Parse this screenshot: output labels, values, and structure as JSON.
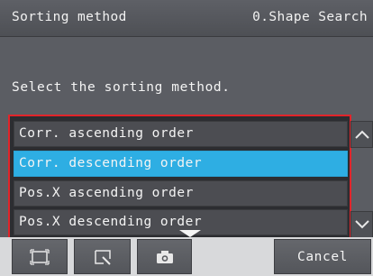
{
  "header": {
    "title": "Sorting method",
    "context": "0.Shape Search"
  },
  "prompt": "Select the sorting method.",
  "sort_options": [
    {
      "label": "Corr. ascending order",
      "selected": false
    },
    {
      "label": "Corr. descending order",
      "selected": true
    },
    {
      "label": "Pos.X ascending order",
      "selected": false
    },
    {
      "label": "Pos.X descending order",
      "selected": false
    }
  ],
  "scroll": {
    "up_icon": "chevron-up-icon",
    "down_icon": "chevron-down-icon",
    "more_indicator_icon": "triangle-down-icon"
  },
  "toolbar": {
    "fit_icon": "fit-screen-icon",
    "zoom_icon": "zoom-window-icon",
    "camera_icon": "camera-icon",
    "cancel_label": "Cancel"
  },
  "colors": {
    "highlight": "#e1242a",
    "selected_row": "#2eaee3",
    "panel": "#5b5d63"
  }
}
